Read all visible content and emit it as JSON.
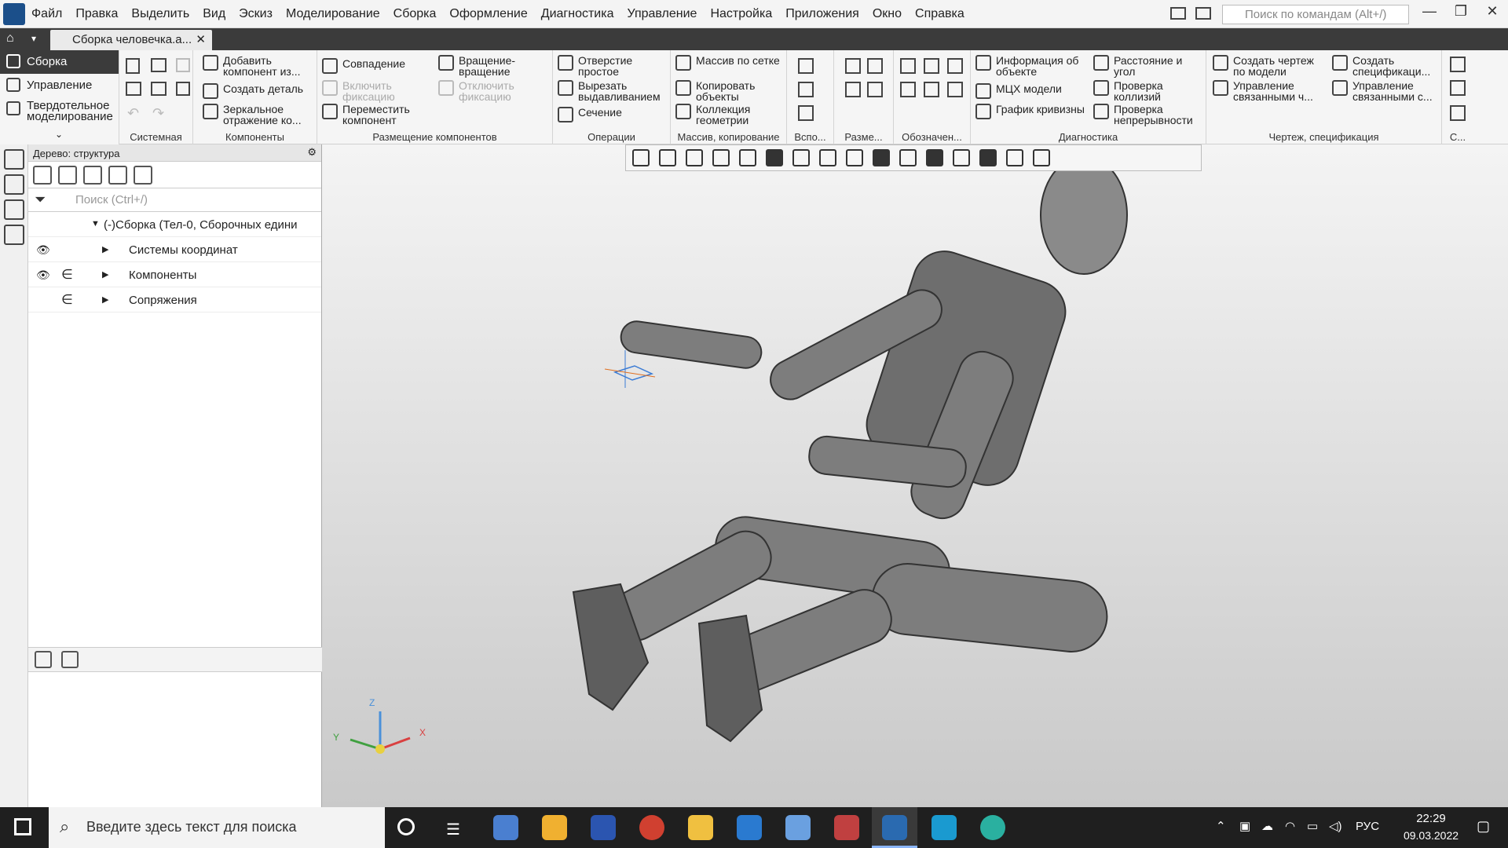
{
  "menubar": {
    "items": [
      "Файл",
      "Правка",
      "Выделить",
      "Вид",
      "Эскиз",
      "Моделирование",
      "Сборка",
      "Оформление",
      "Диагностика",
      "Управление",
      "Настройка",
      "Приложения",
      "Окно",
      "Справка"
    ],
    "search_placeholder": "Поиск по командам (Alt+/)"
  },
  "tabbar": {
    "doc_tab": "Сборка человечка.a..."
  },
  "modes": {
    "active": "Сборка",
    "items": [
      "Управление",
      "Твердотельное моделирование"
    ]
  },
  "ribbon": {
    "groups": [
      "Системная",
      "Компоненты",
      "Размещение компонентов",
      "Операции",
      "Массив, копирование",
      "Вспо...",
      "Разме...",
      "Обозначен...",
      "Диагностика",
      "Чертеж, спецификация",
      "С..."
    ],
    "components": [
      "Добавить компонент из...",
      "Создать деталь",
      "Зеркальное отражение ко..."
    ],
    "placement": [
      "Совпадение",
      "Вращение-вращение",
      "Включить фиксацию",
      "Отключить фиксацию",
      "Переместить компонент"
    ],
    "operations": [
      "Отверстие простое",
      "Вырезать выдавливанием",
      "Сечение"
    ],
    "array": [
      "Массив по сетке",
      "Копировать объекты",
      "Коллекция геометрии"
    ],
    "diagnostics": [
      "Информация об объекте",
      "Расстояние и угол",
      "МЦХ модели",
      "Проверка коллизий",
      "График кривизны",
      "Проверка непрерывности"
    ],
    "drawing": [
      "Создать чертеж по модели",
      "Создать спецификаци...",
      "Управление связанными ч...",
      "Управление связанными с..."
    ]
  },
  "tree": {
    "title": "Дерево: структура",
    "search_placeholder": "Поиск (Ctrl+/)",
    "root": "(-)Сборка (Тел-0, Сборочных едини",
    "rows": [
      "Системы координат",
      "Компоненты",
      "Сопряжения"
    ]
  },
  "axes": {
    "x": "X",
    "y": "Y",
    "z": "Z"
  },
  "taskbar": {
    "search_placeholder": "Введите здесь текст для поиска",
    "lang": "РУС",
    "time": "22:29",
    "date": "09.03.2022"
  },
  "colors": {
    "dark_bar": "#3b3b3b",
    "model": "#7a7a7a",
    "accent": "#1b4f8a"
  }
}
